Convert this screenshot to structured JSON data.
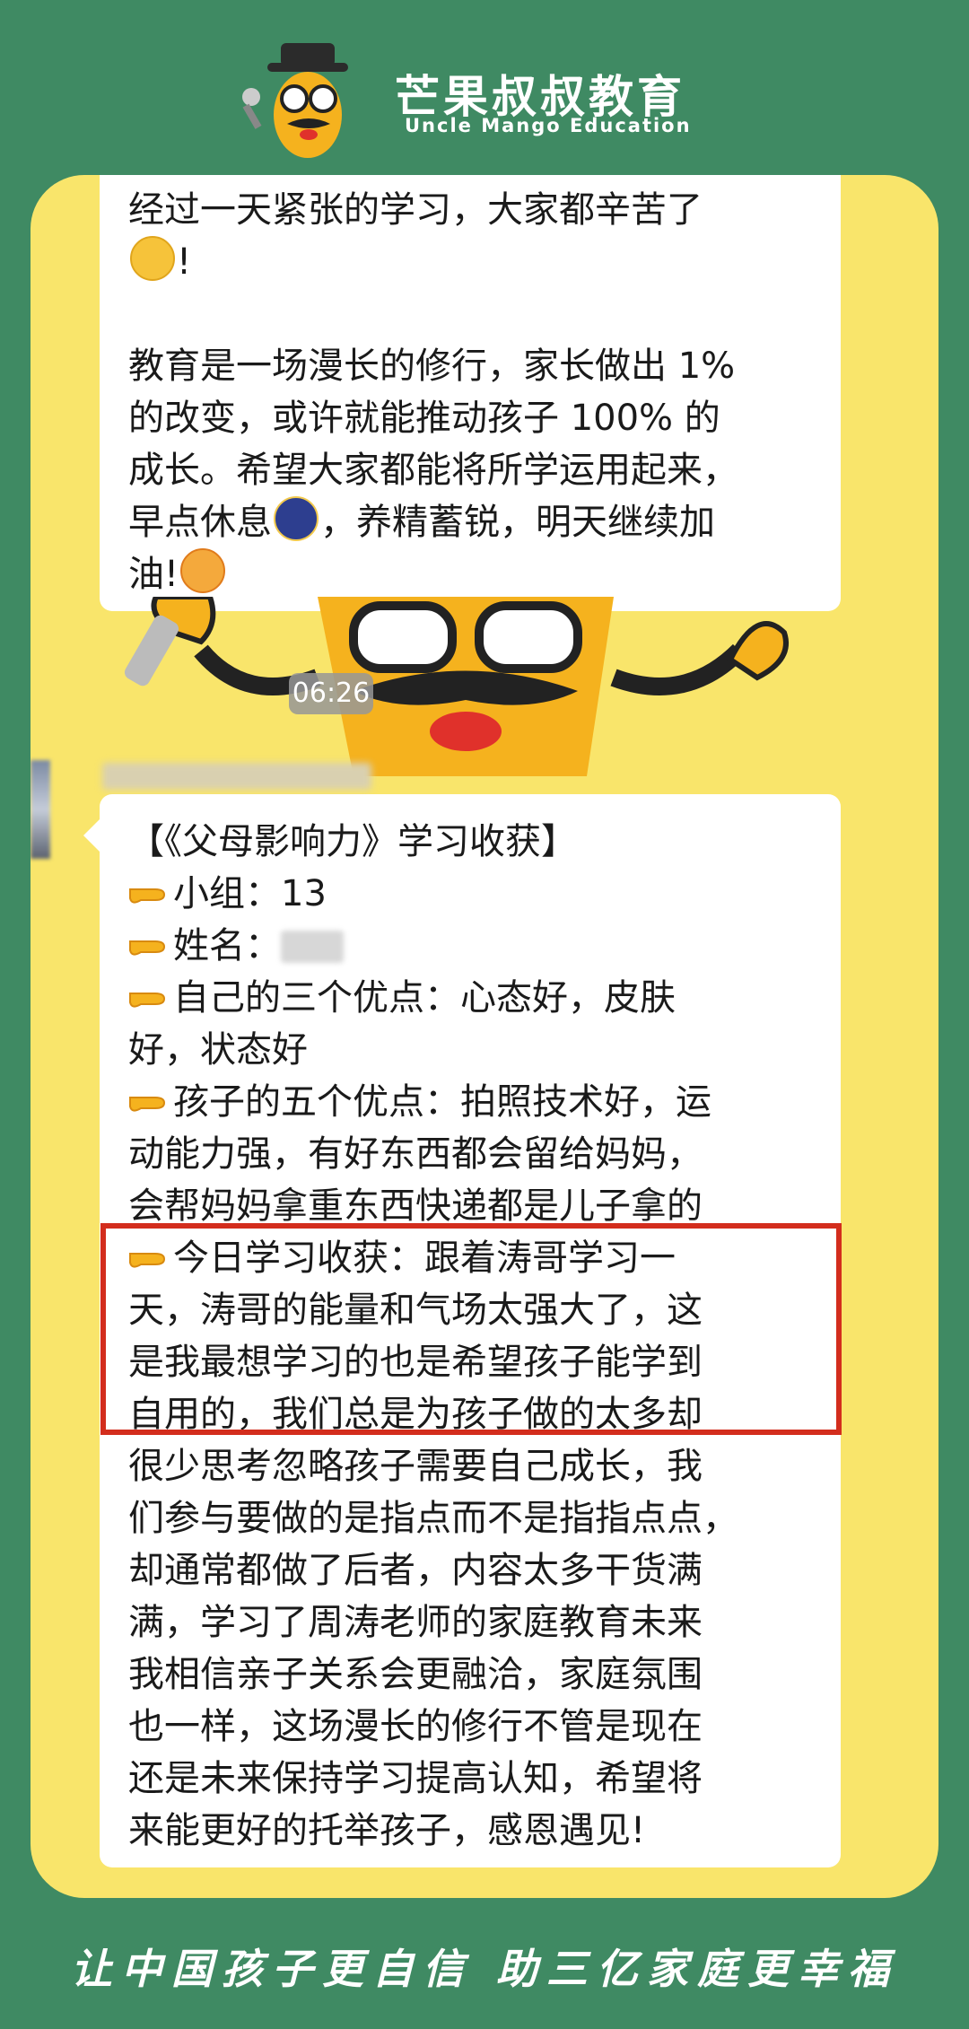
{
  "header": {
    "brand_cn": "芒果叔叔教育",
    "brand_en": "Uncle Mango Education"
  },
  "chat": {
    "bubble1_lines": [
      "经过一天紧张的学习，大家都辛苦了",
      "!",
      "教育是一场漫长的修行，家长做出 1%",
      "的改变，或许就能推动孩子 100% 的",
      "成长。希望大家都能将所学运用起来，",
      "早点休息",
      "，养精蓄锐，明天继续加",
      "油!"
    ],
    "timestamp": "06:26",
    "bubble2_lines": [
      "【《父母影响力》学习收获】",
      "小组：13",
      "姓名：",
      "自己的三个优点：心态好，皮肤",
      "好，状态好",
      "孩子的五个优点：拍照技术好，运",
      "动能力强，有好东西都会留给妈妈，",
      "会帮妈妈拿重东西快递都是儿子拿的",
      "今日学习收获：跟着涛哥学习一",
      "天，涛哥的能量和气场太强大了，这",
      "是我最想学习的也是希望孩子能学到",
      "自用的，我们总是为孩子做的太多却",
      "很少思考忽略孩子需要自己成长，我",
      "们参与要做的是指点而不是指指点点，",
      "却通常都做了后者，内容太多干货满",
      "满，学习了周涛老师的家庭教育未来",
      "我相信亲子关系会更融洽，家庭氛围",
      "也一样，这场漫长的修行不管是现在",
      "还是未来保持学习提高认知，希望将",
      "来能更好的托举孩子，感恩遇见!"
    ]
  },
  "footer": {
    "slogan": "让中国孩子更自信 助三亿家庭更幸福"
  },
  "colors": {
    "background": "#3f8a63",
    "card": "#f9e56b",
    "highlight": "#d32d1d"
  },
  "icons": [
    "mascot-logo-icon",
    "smiling-person-emoji",
    "moon-emoji",
    "determined-face-emoji",
    "pointing-hand-icon"
  ]
}
